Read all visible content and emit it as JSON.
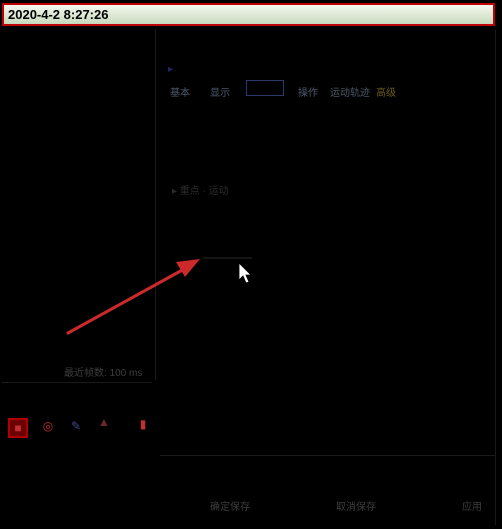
{
  "timestamp": "2020-4-2 8:27:26",
  "tabs": [
    "基本",
    "显示",
    "",
    "操作",
    "运动轨迹",
    "高级"
  ],
  "background_texts": {
    "line1": "▸",
    "line2": "▸ 重点 · 运动"
  },
  "bottom_left_label": "最近帧数: 100 ms",
  "bottom_buttons": [
    "确定保存",
    "取消保存",
    "应用"
  ],
  "colors": {
    "timestamp_border": "#c00000",
    "arrow": "#cc2a2a",
    "background": "#000000"
  },
  "icons": [
    "record-icon",
    "snapshot-icon",
    "edit-icon",
    "pin-icon",
    "delete-icon"
  ]
}
